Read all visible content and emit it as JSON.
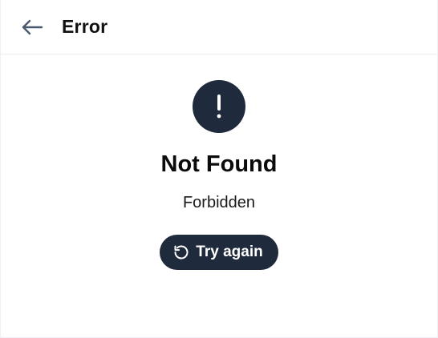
{
  "header": {
    "back_icon": "arrow-left-icon",
    "title": "Error"
  },
  "error": {
    "icon": "exclamation-icon",
    "title": "Not Found",
    "message": "Forbidden"
  },
  "retry_button": {
    "icon": "rotate-ccw-icon",
    "label": "Try again"
  },
  "colors": {
    "accent_dark": "#1f2a3c",
    "back_arrow": "#4a5870",
    "divider": "#eceef1"
  }
}
